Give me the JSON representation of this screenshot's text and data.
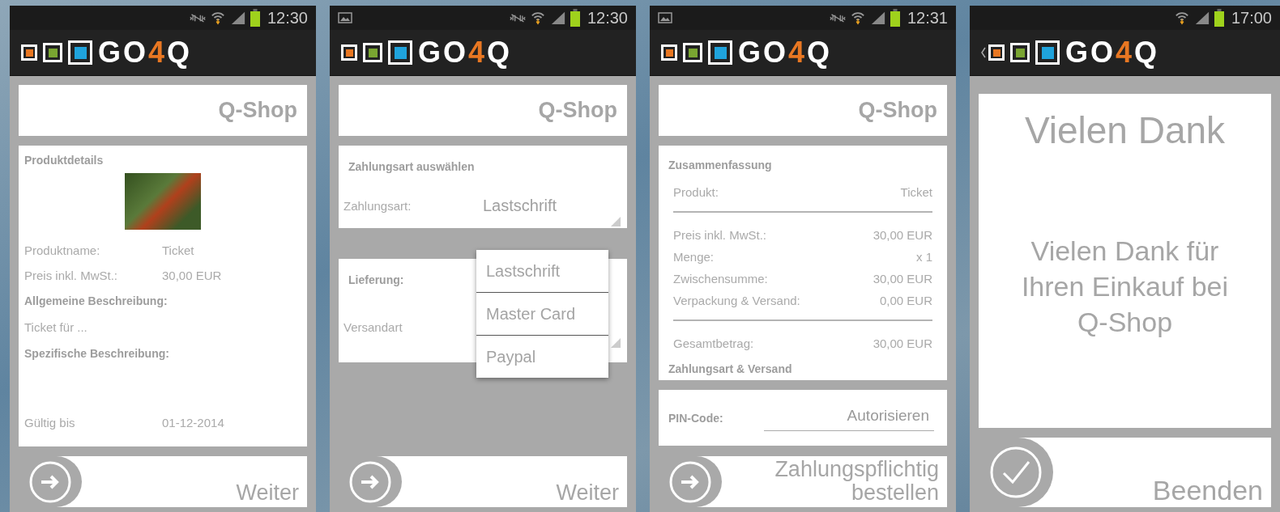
{
  "phones": [
    {
      "kind": "product",
      "status": {
        "time": "12:30",
        "gallery_notification": false,
        "silent_mode": true
      },
      "back_arrow": false,
      "logo": {
        "lead": "GO",
        "accent": "4",
        "tail": "Q"
      },
      "shop_title": "Q-Shop",
      "card": {
        "title": "Produktdetails",
        "items": [
          {
            "kind": "photo"
          },
          {
            "kind": "pair",
            "label": "Produktname:",
            "value": "Ticket"
          },
          {
            "kind": "pair",
            "label": "Preis inkl. MwSt.:",
            "value": "30,00 EUR"
          },
          {
            "kind": "heading",
            "text": "Allgemeine Beschreibung:"
          },
          {
            "kind": "text",
            "text": "Ticket für ..."
          },
          {
            "kind": "heading",
            "text": "Spezifische Beschreibung:"
          },
          {
            "kind": "pair",
            "label": "Gültig bis",
            "value": "01-12-2014"
          }
        ]
      },
      "footer": {
        "kind": "next",
        "label": "Weiter"
      }
    },
    {
      "kind": "payment",
      "status": {
        "time": "12:30",
        "gallery_notification": true,
        "silent_mode": true
      },
      "back_arrow": false,
      "logo": {
        "lead": "GO",
        "accent": "4",
        "tail": "Q"
      },
      "shop_title": "Q-Shop",
      "cards": [
        {
          "title": "Zahlungsart auswählen",
          "label": "Zahlungsart:",
          "value": "Lastschrift"
        },
        {
          "title": "Lieferung:",
          "label": "Versandart"
        }
      ],
      "dropdown": {
        "options": [
          "Lastschrift",
          "Master Card",
          "Paypal"
        ]
      },
      "footer": {
        "kind": "next",
        "label": "Weiter"
      }
    },
    {
      "kind": "summary",
      "status": {
        "time": "12:31",
        "gallery_notification": true,
        "silent_mode": true
      },
      "back_arrow": false,
      "logo": {
        "lead": "GO",
        "accent": "4",
        "tail": "Q"
      },
      "shop_title": "Q-Shop",
      "card": {
        "title": "Zusammenfassung",
        "items": [
          {
            "kind": "pair",
            "label": "Produkt:",
            "value": "Ticket"
          },
          {
            "kind": "rule"
          },
          {
            "kind": "pair",
            "label": "Preis inkl. MwSt.:",
            "value": "30,00 EUR"
          },
          {
            "kind": "pair",
            "label": "Menge:",
            "value": "x 1"
          },
          {
            "kind": "pair",
            "label": "Zwischensumme:",
            "value": "30,00 EUR"
          },
          {
            "kind": "pair",
            "label": "Verpackung & Versand:",
            "value": "0,00 EUR"
          },
          {
            "kind": "rule"
          },
          {
            "kind": "pair",
            "label": "Gesamtbetrag:",
            "value": "30,00 EUR"
          },
          {
            "kind": "heading",
            "text": "Zahlungsart & Versand"
          }
        ]
      },
      "pin": {
        "label": "PIN-Code:",
        "action": "Autorisieren"
      },
      "footer": {
        "kind": "next",
        "label": "Zahlungspflichtig bestellen"
      }
    },
    {
      "kind": "thanks",
      "status": {
        "time": "17:00",
        "gallery_notification": false,
        "silent_mode": false
      },
      "back_arrow": true,
      "logo": {
        "lead": "GO",
        "accent": "4",
        "tail": "Q"
      },
      "thanks": {
        "title": "Vielen Dank",
        "message": "Vielen Dank für Ihren Einkauf bei Q-Shop"
      },
      "footer": {
        "kind": "finish",
        "label": "Beenden"
      }
    }
  ]
}
